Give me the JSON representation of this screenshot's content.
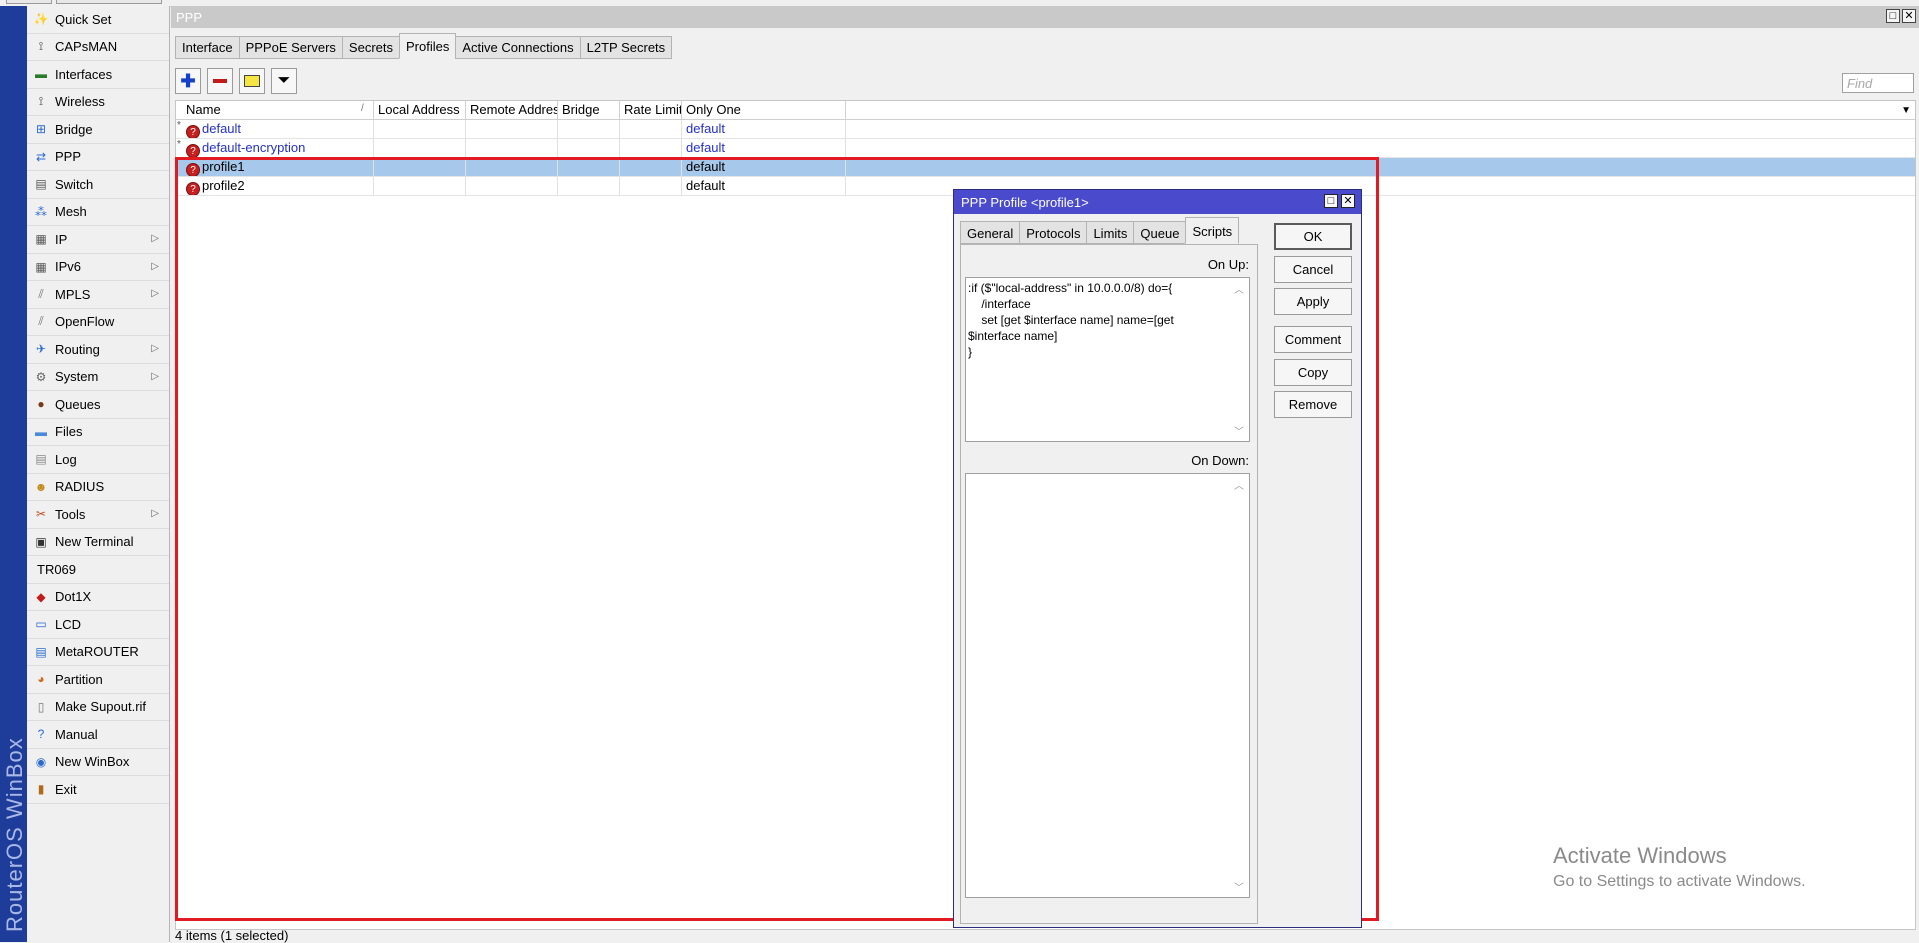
{
  "brand": "RouterOS WinBox",
  "menu": [
    {
      "label": "Quick Set",
      "icon": "wand-icon",
      "submenu": false
    },
    {
      "label": "CAPsMAN",
      "icon": "antenna-icon",
      "submenu": false
    },
    {
      "label": "Interfaces",
      "icon": "interfaces-icon",
      "submenu": false
    },
    {
      "label": "Wireless",
      "icon": "antenna-icon",
      "submenu": false
    },
    {
      "label": "Bridge",
      "icon": "bridge-icon",
      "submenu": false
    },
    {
      "label": "PPP",
      "icon": "ppp-icon",
      "submenu": false
    },
    {
      "label": "Switch",
      "icon": "switch-icon",
      "submenu": false
    },
    {
      "label": "Mesh",
      "icon": "mesh-icon",
      "submenu": false
    },
    {
      "label": "IP",
      "icon": "ip-icon",
      "submenu": true
    },
    {
      "label": "IPv6",
      "icon": "ipv6-icon",
      "submenu": true
    },
    {
      "label": "MPLS",
      "icon": "mpls-icon",
      "submenu": true
    },
    {
      "label": "OpenFlow",
      "icon": "openflow-icon",
      "submenu": false
    },
    {
      "label": "Routing",
      "icon": "routing-icon",
      "submenu": true
    },
    {
      "label": "System",
      "icon": "gear-icon",
      "submenu": true
    },
    {
      "label": "Queues",
      "icon": "queues-icon",
      "submenu": false
    },
    {
      "label": "Files",
      "icon": "folder-icon",
      "submenu": false
    },
    {
      "label": "Log",
      "icon": "log-icon",
      "submenu": false
    },
    {
      "label": "RADIUS",
      "icon": "users-icon",
      "submenu": false
    },
    {
      "label": "Tools",
      "icon": "tools-icon",
      "submenu": true
    },
    {
      "label": "New Terminal",
      "icon": "terminal-icon",
      "submenu": false
    },
    {
      "label": "TR069",
      "icon": "",
      "submenu": false
    },
    {
      "label": "Dot1X",
      "icon": "dot1x-icon",
      "submenu": false
    },
    {
      "label": "LCD",
      "icon": "monitor-icon",
      "submenu": false
    },
    {
      "label": "MetaROUTER",
      "icon": "metarouter-icon",
      "submenu": false
    },
    {
      "label": "Partition",
      "icon": "pie-icon",
      "submenu": false
    },
    {
      "label": "Make Supout.rif",
      "icon": "document-icon",
      "submenu": false
    },
    {
      "label": "Manual",
      "icon": "help-icon",
      "submenu": false
    },
    {
      "label": "New WinBox",
      "icon": "globe-icon",
      "submenu": false
    },
    {
      "label": "Exit",
      "icon": "exit-icon",
      "submenu": false
    }
  ],
  "window": {
    "title": "PPP",
    "tabs": [
      "Interface",
      "PPPoE Servers",
      "Secrets",
      "Profiles",
      "Active Connections",
      "L2TP Secrets"
    ],
    "active_tab": "Profiles",
    "find_placeholder": "Find",
    "columns": [
      "Name",
      "Local Address",
      "Remote Address",
      "Bridge",
      "Rate Limit...",
      "Only One"
    ],
    "rows": [
      {
        "mark": "*",
        "name": "default",
        "only_one": "default",
        "selected": false,
        "system": true
      },
      {
        "mark": "*",
        "name": "default-encryption",
        "only_one": "default",
        "selected": false,
        "system": true
      },
      {
        "mark": "",
        "name": "profile1",
        "only_one": "default",
        "selected": true,
        "system": false
      },
      {
        "mark": "",
        "name": "profile2",
        "only_one": "default",
        "selected": false,
        "system": false
      }
    ],
    "status": "4 items (1 selected)"
  },
  "dialog": {
    "title": "PPP Profile <profile1>",
    "tabs": [
      "General",
      "Protocols",
      "Limits",
      "Queue",
      "Scripts"
    ],
    "active_tab": "Scripts",
    "on_up_label": "On Up:",
    "on_up_value": ":if ($\"local-address\" in 10.0.0.0/8) do={\n    /interface\n    set [get $interface name] name=[get\n$interface name]\n}",
    "on_down_label": "On Down:",
    "on_down_value": "",
    "buttons": [
      "OK",
      "Cancel",
      "Apply",
      "Comment",
      "Copy",
      "Remove"
    ]
  },
  "watermark": {
    "line1": "Activate Windows",
    "line2": "Go to Settings to activate Windows."
  },
  "colors": {
    "brand_bar": "#1e3c9a",
    "selection": "#a6c8ea",
    "dialog_title": "#4a4acc",
    "highlight": "#e21b23",
    "system_text": "#2431c8"
  }
}
